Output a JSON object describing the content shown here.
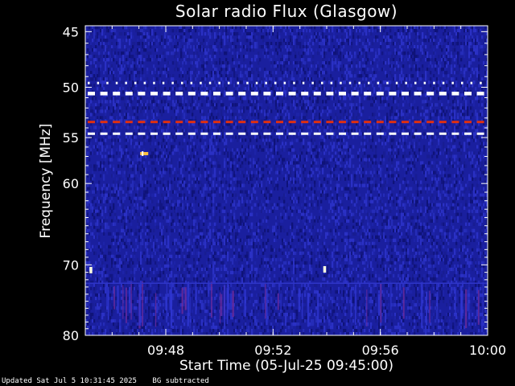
{
  "chart_data": {
    "type": "heatmap",
    "title": "Solar radio Flux (Glasgow)",
    "xlabel": "Start Time (05-Jul-25 09:45:00)",
    "ylabel": "Frequency [MHz]",
    "xlim": [
      "09:45:00",
      "10:00:00"
    ],
    "ylim_mhz": [
      44.5,
      80
    ],
    "y_scale": "log",
    "y_ticks": [
      45,
      50,
      55,
      60,
      70,
      80
    ],
    "x_ticks": [
      "09:48",
      "09:52",
      "09:56",
      "10:00"
    ],
    "x_minor_tick_interval_min": 1,
    "colormap": "blue-red-yellow-white",
    "background_color": "#1a1f9e",
    "interference_bands": [
      {
        "freq_mhz": 49.6,
        "pattern": "dotted",
        "color": "#ffffff"
      },
      {
        "freq_mhz": 50.6,
        "pattern": "dashed",
        "color": "#ffffff"
      },
      {
        "freq_mhz": 53.4,
        "pattern": "dashed",
        "color": "#e03010"
      },
      {
        "freq_mhz": 54.6,
        "pattern": "dashed",
        "color": "#ffffff"
      }
    ],
    "bursts": [
      {
        "time": "09:47:10",
        "freq_mhz": 56.7,
        "color": "#ffc040"
      },
      {
        "time": "09:45:12",
        "freq_mhz": 70.7,
        "color": "#ffffe0"
      },
      {
        "time": "09:53:55",
        "freq_mhz": 70.6,
        "color": "#ffffe0"
      }
    ],
    "background_note": "BG subtracted"
  },
  "footer": {
    "updated": "Updated Sat Jul  5 10:31:45 2025",
    "bg_note": "BG subtracted"
  },
  "colors": {
    "page_background": "#000000",
    "axis": "#ffffff",
    "plot_background": "#1a1f9e"
  }
}
